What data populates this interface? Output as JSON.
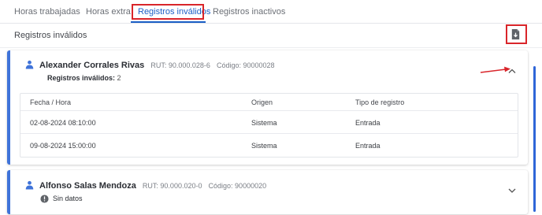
{
  "tabs": [
    {
      "label": "Horas trabajadas"
    },
    {
      "label": "Horas extra"
    },
    {
      "label": "Registros inválidos"
    },
    {
      "label": "Registros inactivos"
    }
  ],
  "active_tab": "Registros inválidos",
  "section": {
    "title": "Registros inválidos"
  },
  "colors": {
    "accent": "#3f73d9",
    "highlight": "#d9252a",
    "active_tab": "#1b5fc6"
  },
  "employees": [
    {
      "name": "Alexander Corrales Rivas",
      "rut": "RUT: 90.000.028-6",
      "code": "Código: 90000028",
      "invalid_label": "Registros inválidos:",
      "invalid_count": "2",
      "table": {
        "headers": [
          "Fecha / Hora",
          "Origen",
          "Tipo de registro"
        ],
        "rows": [
          [
            "02-08-2024 08:10:00",
            "Sistema",
            "Entrada"
          ],
          [
            "09-08-2024 15:00:00",
            "Sistema",
            "Entrada"
          ]
        ]
      }
    },
    {
      "name": "Alfonso Salas Mendoza",
      "rut": "RUT: 90.000.020-0",
      "code": "Código: 90000020",
      "status": "Sin datos"
    }
  ],
  "icons": {
    "download": "download-file-icon",
    "person": "person-icon",
    "collapse": "chevron-up-icon",
    "expand": "chevron-down-icon",
    "info": "info-icon"
  }
}
